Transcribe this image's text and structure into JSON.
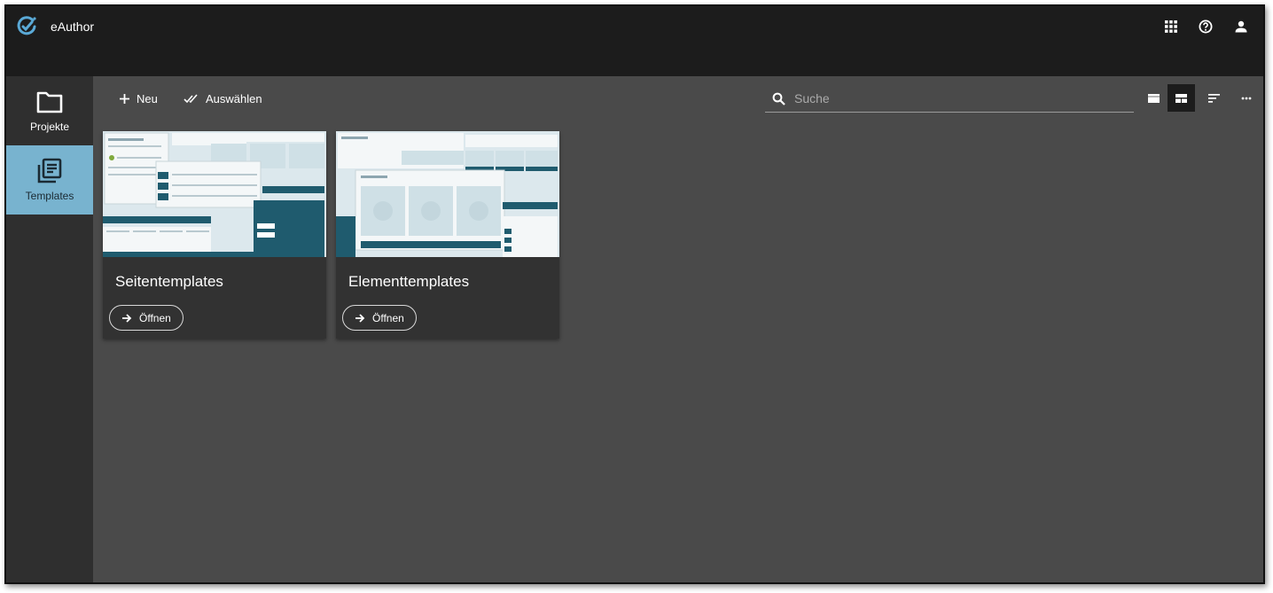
{
  "app": {
    "title": "eAuthor",
    "logo_icon": "eauthor-logo-icon"
  },
  "topbar": {
    "icons": [
      "apps-grid-icon",
      "help-icon",
      "user-icon"
    ]
  },
  "sidebar": {
    "items": [
      {
        "label": "Projekte",
        "icon": "folder-icon",
        "active": false
      },
      {
        "label": "Templates",
        "icon": "library-books-icon",
        "active": true
      }
    ],
    "active_color": "#78b3cf"
  },
  "toolbar": {
    "new_label": "Neu",
    "select_label": "Auswählen",
    "search_placeholder": "Suche",
    "view_buttons": [
      "list-view-icon",
      "tile-view-icon",
      "sort-icon",
      "more-icon"
    ],
    "active_view": "tile-view-icon"
  },
  "cards": [
    {
      "title": "Seitentemplates",
      "open_label": "Öffnen"
    },
    {
      "title": "Elementtemplates",
      "open_label": "Öffnen"
    }
  ],
  "colors": {
    "topbar": "#1c1c1c",
    "sidebar": "#2f2f2f",
    "content": "#4a4a4a",
    "card": "#323232",
    "accent_teal": "#1f5b6e"
  }
}
